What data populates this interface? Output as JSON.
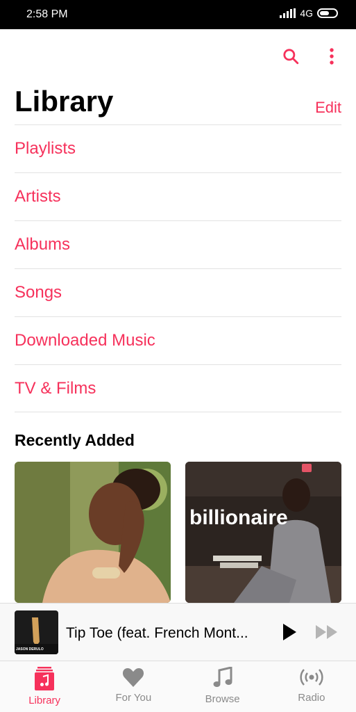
{
  "status": {
    "time": "2:58 PM",
    "network": "4G"
  },
  "header": {
    "title": "Library",
    "edit_label": "Edit"
  },
  "icons": {
    "search": "search-icon",
    "more": "more-vert-icon"
  },
  "library_items": [
    {
      "label": "Playlists"
    },
    {
      "label": "Artists"
    },
    {
      "label": "Albums"
    },
    {
      "label": "Songs"
    },
    {
      "label": "Downloaded Music"
    },
    {
      "label": "TV & Films"
    }
  ],
  "recently_added": {
    "title": "Recently Added",
    "albums": [
      {
        "art_text": ""
      },
      {
        "art_text": "billionaire"
      }
    ]
  },
  "now_playing": {
    "track": "Tip Toe (feat. French Mont...",
    "art_text": "JASON DERULO"
  },
  "tabs": [
    {
      "label": "Library",
      "active": true
    },
    {
      "label": "For You",
      "active": false
    },
    {
      "label": "Browse",
      "active": false
    },
    {
      "label": "Radio",
      "active": false
    }
  ],
  "colors": {
    "accent": "#f6315b",
    "inactive": "#8a8a8a"
  }
}
